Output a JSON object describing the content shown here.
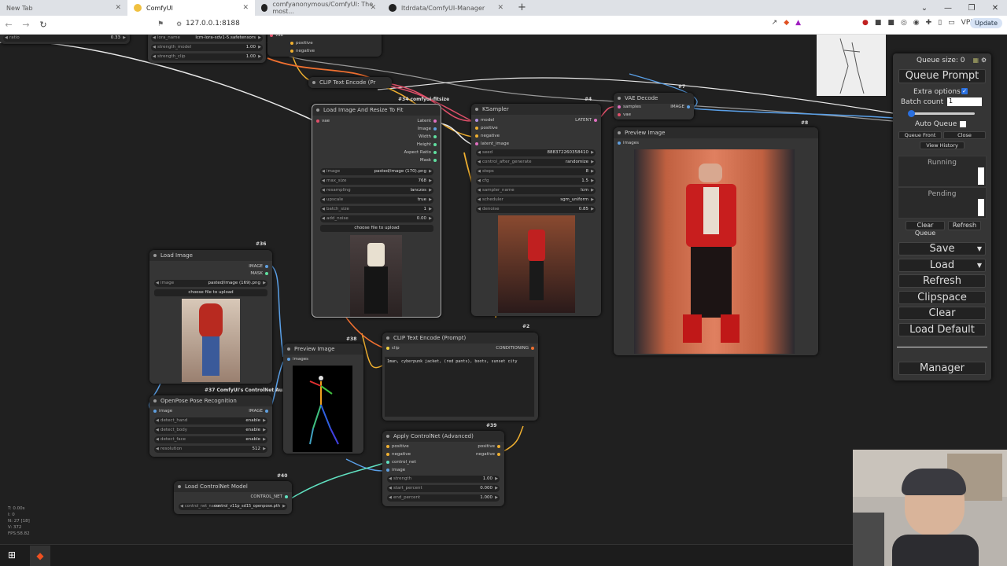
{
  "browser": {
    "tabs": [
      {
        "label": "New Tab",
        "active": false
      },
      {
        "label": "ComfyUI",
        "active": true
      },
      {
        "label": "comfyanonymous/ComfyUI: The most...",
        "active": false
      },
      {
        "label": "ltdrdata/ComfyUI-Manager",
        "active": false
      }
    ],
    "url": "127.0.0.1:8188",
    "vpn_label": "VPN",
    "update_label": "Update"
  },
  "nodes": {
    "lora": {
      "ratio_label": "ratio",
      "ratio_value": "0.33",
      "lora_name_label": "lora_name",
      "lora_name_value": "lcm-lora-sdv1-5.safetensors",
      "strength_model_label": "strength_model",
      "strength_model_value": "1.00",
      "strength_clip_label": "strength_clip",
      "strength_clip_value": "1.00",
      "out_vae": "vae",
      "out_positive": "positive",
      "out_negative": "negative"
    },
    "clip_top": {
      "title": "CLIP Text Encode (Pr"
    },
    "load_resize": {
      "badge": "#34 comfyui-fitsize",
      "title": "Load Image And Resize To Fit",
      "in_vae": "vae",
      "outputs": [
        "Latent",
        "Image",
        "Width",
        "Height",
        "Aspect Ratio",
        "Mask"
      ],
      "widgets": [
        {
          "label": "image",
          "value": "pasted/image (170).png"
        },
        {
          "label": "max_size",
          "value": "768"
        },
        {
          "label": "resampling",
          "value": "lanczos"
        },
        {
          "label": "upscale",
          "value": "true"
        },
        {
          "label": "batch_size",
          "value": "1"
        },
        {
          "label": "add_noise",
          "value": "0.00"
        }
      ],
      "upload_label": "choose file to upload"
    },
    "ksampler": {
      "badge": "#4",
      "title": "KSampler",
      "inputs": [
        "model",
        "positive",
        "negative",
        "latent_image"
      ],
      "out_latent": "LATENT",
      "widgets": [
        {
          "label": "seed",
          "value": "888372260358410"
        },
        {
          "label": "control_after_generate",
          "value": "randomize"
        },
        {
          "label": "steps",
          "value": "8"
        },
        {
          "label": "cfg",
          "value": "1.5"
        },
        {
          "label": "sampler_name",
          "value": "lcm"
        },
        {
          "label": "scheduler",
          "value": "sgm_uniform"
        },
        {
          "label": "denoise",
          "value": "0.85"
        }
      ]
    },
    "vae_decode": {
      "badge": "#7",
      "title": "VAE Decode",
      "in_samples": "samples",
      "in_vae": "vae",
      "out_image": "IMAGE"
    },
    "preview_main": {
      "badge": "#8",
      "title": "Preview Image",
      "in_images": "images"
    },
    "load_image": {
      "badge": "#36",
      "title": "Load Image",
      "out_image": "IMAGE",
      "out_mask": "MASK",
      "image_label": "image",
      "image_value": "pasted/image (169).png",
      "upload_label": "choose file to upload"
    },
    "openpose": {
      "badge": "#37 ComfyUI's ControlNet Au...",
      "title": "OpenPose Pose Recognition",
      "in_image": "image",
      "out_image": "IMAGE",
      "widgets": [
        {
          "label": "detect_hand",
          "value": "enable"
        },
        {
          "label": "detect_body",
          "value": "enable"
        },
        {
          "label": "detect_face",
          "value": "enable"
        },
        {
          "label": "resolution",
          "value": "512"
        }
      ]
    },
    "preview_pose": {
      "badge": "#38",
      "title": "Preview Image",
      "in_images": "images"
    },
    "clip_prompt": {
      "badge": "#2",
      "title": "CLIP Text Encode (Prompt)",
      "in_clip": "clip",
      "out_cond": "CONDITIONING",
      "text": "1man, cyberpunk jacket, (red pants), boots, sunset city"
    },
    "controlnet_apply": {
      "badge": "#39",
      "title": "Apply ControlNet (Advanced)",
      "inputs": [
        "positive",
        "negative",
        "control_net",
        "image"
      ],
      "outputs": [
        "positive",
        "negative"
      ],
      "widgets": [
        {
          "label": "strength",
          "value": "1.00"
        },
        {
          "label": "start_percent",
          "value": "0.000"
        },
        {
          "label": "end_percent",
          "value": "1.000"
        }
      ]
    },
    "controlnet_loader": {
      "badge": "#40",
      "title": "Load ControlNet Model",
      "out": "CONTROL_NET",
      "widget_label": "control_net_name",
      "widget_value": "control_v11p_sd15_openpose.pth"
    }
  },
  "queue_panel": {
    "queue_size_label": "Queue size: 0",
    "queue_prompt": "Queue Prompt",
    "extra_options": "Extra options",
    "batch_count_label": "Batch count",
    "batch_count_value": "1",
    "auto_queue": "Auto Queue",
    "queue_front": "Queue Front",
    "close": "Close",
    "view_history": "View History",
    "running": "Running",
    "pending": "Pending",
    "clear_queue": "Clear Queue",
    "refresh_small": "Refresh",
    "save": "Save",
    "load": "Load",
    "refresh": "Refresh",
    "clipspace": "Clipspace",
    "clear": "Clear",
    "load_default": "Load Default",
    "manager": "Manager"
  },
  "stats": {
    "t": "T: 0.00s",
    "i": "I: 0",
    "n": "N: 27 [18]",
    "v": "V: 372",
    "fps": "FPS:58.82"
  },
  "colors": {
    "wire_yellow": "#f0b030",
    "wire_red": "#e0506a",
    "wire_blue": "#5aa0e8",
    "wire_white": "#e8e8e8",
    "wire_cyan": "#60e0c0",
    "wire_orange": "#f07030"
  }
}
